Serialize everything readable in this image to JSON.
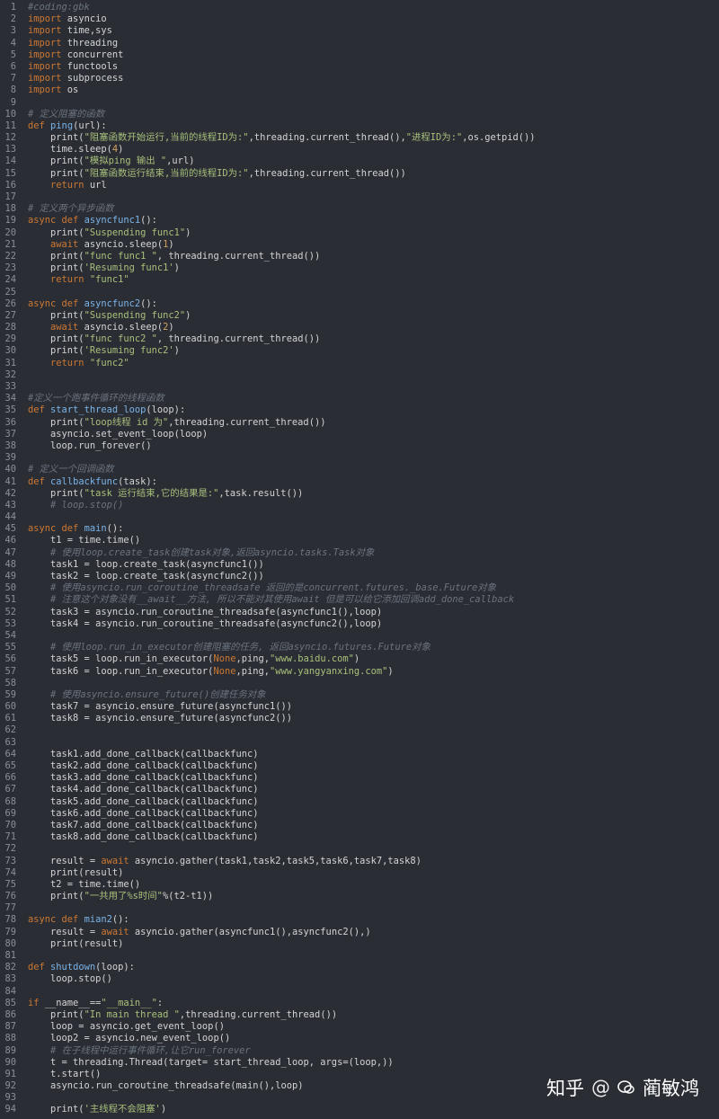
{
  "editor": {
    "lines": [
      [
        {
          "t": "#coding:gbk",
          "c": "cm"
        }
      ],
      [
        {
          "t": "import",
          "c": "kw"
        },
        {
          "t": " asyncio"
        }
      ],
      [
        {
          "t": "import",
          "c": "kw"
        },
        {
          "t": " time,sys"
        }
      ],
      [
        {
          "t": "import",
          "c": "kw"
        },
        {
          "t": " threading"
        }
      ],
      [
        {
          "t": "import",
          "c": "kw"
        },
        {
          "t": " concurrent"
        }
      ],
      [
        {
          "t": "import",
          "c": "kw"
        },
        {
          "t": " functools"
        }
      ],
      [
        {
          "t": "import",
          "c": "kw"
        },
        {
          "t": " subprocess"
        }
      ],
      [
        {
          "t": "import",
          "c": "kw"
        },
        {
          "t": " os"
        }
      ],
      [],
      [
        {
          "t": "# 定义阻塞的函数",
          "c": "cm"
        }
      ],
      [
        {
          "t": "def",
          "c": "kw"
        },
        {
          "t": " "
        },
        {
          "t": "ping",
          "c": "fn"
        },
        {
          "t": "(url):"
        }
      ],
      [
        {
          "t": "    print("
        },
        {
          "t": "\"阻塞函数开始运行,当前的线程ID为:\"",
          "c": "str"
        },
        {
          "t": ",threading.current_thread(),"
        },
        {
          "t": "\"进程ID为:\"",
          "c": "str"
        },
        {
          "t": ",os.getpid())"
        }
      ],
      [
        {
          "t": "    time.sleep("
        },
        {
          "t": "4",
          "c": "num"
        },
        {
          "t": ")"
        }
      ],
      [
        {
          "t": "    print("
        },
        {
          "t": "\"模拟ping 输出 \"",
          "c": "str"
        },
        {
          "t": ",url)"
        }
      ],
      [
        {
          "t": "    print("
        },
        {
          "t": "\"阻塞函数运行结束,当前的线程ID为:\"",
          "c": "str"
        },
        {
          "t": ",threading.current_thread())"
        }
      ],
      [
        {
          "t": "    "
        },
        {
          "t": "return",
          "c": "kw"
        },
        {
          "t": " url"
        }
      ],
      [],
      [
        {
          "t": "# 定义两个异步函数",
          "c": "cm"
        }
      ],
      [
        {
          "t": "async def",
          "c": "kw"
        },
        {
          "t": " "
        },
        {
          "t": "asyncfunc1",
          "c": "fn"
        },
        {
          "t": "():"
        }
      ],
      [
        {
          "t": "    print("
        },
        {
          "t": "\"Suspending func1\"",
          "c": "str"
        },
        {
          "t": ")"
        }
      ],
      [
        {
          "t": "    "
        },
        {
          "t": "await",
          "c": "kw"
        },
        {
          "t": " asyncio.sleep("
        },
        {
          "t": "1",
          "c": "num"
        },
        {
          "t": ")"
        }
      ],
      [
        {
          "t": "    print("
        },
        {
          "t": "\"func func1 \"",
          "c": "str"
        },
        {
          "t": ", threading.current_thread())"
        }
      ],
      [
        {
          "t": "    print("
        },
        {
          "t": "'Resuming func1'",
          "c": "str"
        },
        {
          "t": ")"
        }
      ],
      [
        {
          "t": "    "
        },
        {
          "t": "return",
          "c": "kw"
        },
        {
          "t": " "
        },
        {
          "t": "\"func1\"",
          "c": "str"
        }
      ],
      [],
      [
        {
          "t": "async def",
          "c": "kw"
        },
        {
          "t": " "
        },
        {
          "t": "asyncfunc2",
          "c": "fn"
        },
        {
          "t": "():"
        }
      ],
      [
        {
          "t": "    print("
        },
        {
          "t": "\"Suspending func2\"",
          "c": "str"
        },
        {
          "t": ")"
        }
      ],
      [
        {
          "t": "    "
        },
        {
          "t": "await",
          "c": "kw"
        },
        {
          "t": " asyncio.sleep("
        },
        {
          "t": "2",
          "c": "num"
        },
        {
          "t": ")"
        }
      ],
      [
        {
          "t": "    print("
        },
        {
          "t": "\"func func2 \"",
          "c": "str"
        },
        {
          "t": ", threading.current_thread())"
        }
      ],
      [
        {
          "t": "    print("
        },
        {
          "t": "'Resuming func2'",
          "c": "str"
        },
        {
          "t": ")"
        }
      ],
      [
        {
          "t": "    "
        },
        {
          "t": "return",
          "c": "kw"
        },
        {
          "t": " "
        },
        {
          "t": "\"func2\"",
          "c": "str"
        }
      ],
      [],
      [],
      [
        {
          "t": "#定义一个跑事件循环的线程函数",
          "c": "cm"
        }
      ],
      [
        {
          "t": "def",
          "c": "kw"
        },
        {
          "t": " "
        },
        {
          "t": "start_thread_loop",
          "c": "fn"
        },
        {
          "t": "(loop):"
        }
      ],
      [
        {
          "t": "    print("
        },
        {
          "t": "\"loop线程 id 为\"",
          "c": "str"
        },
        {
          "t": ",threading.current_thread())"
        }
      ],
      [
        {
          "t": "    asyncio.set_event_loop(loop)"
        }
      ],
      [
        {
          "t": "    loop.run_forever()"
        }
      ],
      [],
      [
        {
          "t": "# 定义一个回调函数",
          "c": "cm"
        }
      ],
      [
        {
          "t": "def",
          "c": "kw"
        },
        {
          "t": " "
        },
        {
          "t": "callbackfunc",
          "c": "fn"
        },
        {
          "t": "(task):"
        }
      ],
      [
        {
          "t": "    print("
        },
        {
          "t": "\"task 运行结束,它的结果是:\"",
          "c": "str"
        },
        {
          "t": ",task.result())"
        }
      ],
      [
        {
          "t": "    # loop.stop()",
          "c": "cm"
        }
      ],
      [],
      [
        {
          "t": "async def",
          "c": "kw"
        },
        {
          "t": " "
        },
        {
          "t": "main",
          "c": "fn"
        },
        {
          "t": "():"
        }
      ],
      [
        {
          "t": "    t1 = time.time()"
        }
      ],
      [
        {
          "t": "    # 使用loop.create_task创建task对象,返回asyncio.tasks.Task对象",
          "c": "cm"
        }
      ],
      [
        {
          "t": "    task1 = loop.create_task(asyncfunc1())"
        }
      ],
      [
        {
          "t": "    task2 = loop.create_task(asyncfunc2())"
        }
      ],
      [
        {
          "t": "    # 使用asyncio.run_coroutine_threadsafe 返回的是concurrent.futures._base.Future对象",
          "c": "cm"
        }
      ],
      [
        {
          "t": "    # 注意这个对象没有__await__方法, 所以不能对其使用await 但是可以给它添加回调add_done_callback",
          "c": "cm"
        }
      ],
      [
        {
          "t": "    task3 = asyncio.run_coroutine_threadsafe(asyncfunc1(),loop)"
        }
      ],
      [
        {
          "t": "    task4 = asyncio.run_coroutine_threadsafe(asyncfunc2(),loop)"
        }
      ],
      [],
      [
        {
          "t": "    # 使用loop.run_in_executor创建阻塞的任务, 返回asyncio.futures.Future对象",
          "c": "cm"
        }
      ],
      [
        {
          "t": "    task5 = loop.run_in_executor("
        },
        {
          "t": "None",
          "c": "kw"
        },
        {
          "t": ",ping,"
        },
        {
          "t": "\"www.baidu.com\"",
          "c": "str"
        },
        {
          "t": ")"
        }
      ],
      [
        {
          "t": "    task6 = loop.run_in_executor("
        },
        {
          "t": "None",
          "c": "kw"
        },
        {
          "t": ",ping,"
        },
        {
          "t": "\"www.yangyanxing.com\"",
          "c": "str"
        },
        {
          "t": ")"
        }
      ],
      [],
      [
        {
          "t": "    # 使用asyncio.ensure_future()创建任务对象",
          "c": "cm"
        }
      ],
      [
        {
          "t": "    task7 = asyncio.ensure_future(asyncfunc1())"
        }
      ],
      [
        {
          "t": "    task8 = asyncio.ensure_future(asyncfunc2())"
        }
      ],
      [],
      [],
      [
        {
          "t": "    task1.add_done_callback(callbackfunc)"
        }
      ],
      [
        {
          "t": "    task2.add_done_callback(callbackfunc)"
        }
      ],
      [
        {
          "t": "    task3.add_done_callback(callbackfunc)"
        }
      ],
      [
        {
          "t": "    task4.add_done_callback(callbackfunc)"
        }
      ],
      [
        {
          "t": "    task5.add_done_callback(callbackfunc)"
        }
      ],
      [
        {
          "t": "    task6.add_done_callback(callbackfunc)"
        }
      ],
      [
        {
          "t": "    task7.add_done_callback(callbackfunc)"
        }
      ],
      [
        {
          "t": "    task8.add_done_callback(callbackfunc)"
        }
      ],
      [],
      [
        {
          "t": "    result = "
        },
        {
          "t": "await",
          "c": "kw"
        },
        {
          "t": " asyncio.gather(task1,task2,task5,task6,task7,task8)"
        }
      ],
      [
        {
          "t": "    print(result)"
        }
      ],
      [
        {
          "t": "    t2 = time.time()"
        }
      ],
      [
        {
          "t": "    print("
        },
        {
          "t": "\"一共用了%s时间\"",
          "c": "str"
        },
        {
          "t": "%(t2-t1))"
        }
      ],
      [],
      [
        {
          "t": "async def",
          "c": "kw"
        },
        {
          "t": " "
        },
        {
          "t": "mian2",
          "c": "fn"
        },
        {
          "t": "():"
        }
      ],
      [
        {
          "t": "    result = "
        },
        {
          "t": "await",
          "c": "kw"
        },
        {
          "t": " asyncio.gather(asyncfunc1(),asyncfunc2(),)"
        }
      ],
      [
        {
          "t": "    print(result)"
        }
      ],
      [],
      [
        {
          "t": "def",
          "c": "kw"
        },
        {
          "t": " "
        },
        {
          "t": "shutdown",
          "c": "fn"
        },
        {
          "t": "(loop):"
        }
      ],
      [
        {
          "t": "    loop.stop()"
        }
      ],
      [],
      [
        {
          "t": "if",
          "c": "kw"
        },
        {
          "t": " __name__=="
        },
        {
          "t": "\"__main__\"",
          "c": "str"
        },
        {
          "t": ":"
        }
      ],
      [
        {
          "t": "    print("
        },
        {
          "t": "\"In main thread \"",
          "c": "str"
        },
        {
          "t": ",threading.current_thread())"
        }
      ],
      [
        {
          "t": "    loop = asyncio.get_event_loop()"
        }
      ],
      [
        {
          "t": "    loop2 = asyncio.new_event_loop()"
        }
      ],
      [
        {
          "t": "    # 在子线程中运行事件循环,让它run_forever",
          "c": "cm"
        }
      ],
      [
        {
          "t": "    t = threading.Thread(target= start_thread_loop, args=(loop,))"
        }
      ],
      [
        {
          "t": "    t.start()"
        }
      ],
      [
        {
          "t": "    asyncio.run_coroutine_threadsafe(main(),loop)"
        }
      ],
      [],
      [
        {
          "t": "    print("
        },
        {
          "t": "'主线程不会阻塞'",
          "c": "str"
        },
        {
          "t": ")"
        }
      ]
    ]
  },
  "watermark": {
    "site": "知乎",
    "at": "@",
    "author": "蔺敏鸿"
  },
  "colors": {
    "background": "#2b2d35",
    "keyword": "#cc7832",
    "function": "#7ab4e8",
    "string": "#a8c07a",
    "comment": "#6a737d"
  }
}
